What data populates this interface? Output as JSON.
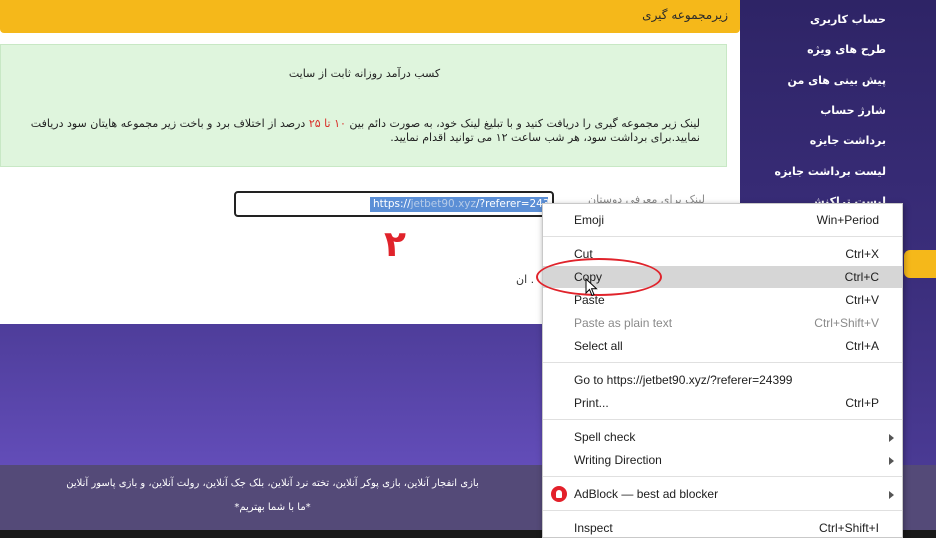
{
  "sidebar": {
    "items": [
      {
        "label": "حساب کاربری"
      },
      {
        "label": "طرح های ویژه"
      },
      {
        "label": "پیش بینی های من"
      },
      {
        "label": "شارژ حساب"
      },
      {
        "label": "برداشت جایزه"
      },
      {
        "label": "لیست برداشت جایزه"
      },
      {
        "label": "لیست تراکنش"
      }
    ]
  },
  "header": {
    "title": "زیرمجموعه گیری"
  },
  "info": {
    "heading": "کسب درآمد روزانه ثابت از سایت",
    "body_before": "لینک زیر مجموعه گیری را دریافت کنید و با تبلیغ لینک خود، به صورت دائم بین ",
    "body_highlight": "۱۰ تا ۲۵",
    "body_after": " درصد از اختلاف برد و باخت زیر مجموعه هایتان سود دریافت نمایید.برای برداشت سود، هر شب ساعت ۱۲ می توانید اقدام نمایید."
  },
  "referral": {
    "label": "لینک برای معرفی دوستان",
    "link_prefix": "https://",
    "link_blurred": "jetbet90.xyz",
    "link_suffix": "/?referer=24399"
  },
  "annotation": {
    "step_number": "۲"
  },
  "partial_text": "ان .",
  "footer": {
    "line1": "بازی انفجار آنلاین، بازی پوکر آنلاین، تخته نرد آنلاین، بلک جک آنلاین، رولت آنلاین، و بازی پاسور آنلاین",
    "line2": "*ما با شما بهتریم*"
  },
  "context_menu": {
    "items": [
      {
        "label": "Emoji",
        "shortcut": "Win+Period"
      },
      {
        "label": "Cut",
        "shortcut": "Ctrl+X"
      },
      {
        "label": "Copy",
        "shortcut": "Ctrl+C"
      },
      {
        "label": "Paste",
        "shortcut": "Ctrl+V"
      },
      {
        "label": "Paste as plain text",
        "shortcut": "Ctrl+Shift+V"
      },
      {
        "label": "Select all",
        "shortcut": "Ctrl+A"
      },
      {
        "label": "Go to https://jetbet90.xyz/?referer=24399",
        "shortcut": ""
      },
      {
        "label": "Print...",
        "shortcut": "Ctrl+P"
      },
      {
        "label": "Spell check",
        "shortcut": ""
      },
      {
        "label": "Writing Direction",
        "shortcut": ""
      },
      {
        "label": "AdBlock — best ad blocker",
        "shortcut": ""
      },
      {
        "label": "Inspect",
        "shortcut": "Ctrl+Shift+I"
      }
    ]
  },
  "colors": {
    "header_yellow": "#f5b81a",
    "info_green": "#dff5dd",
    "sidebar_purple": "#2e2466",
    "accent_red": "#e0232b",
    "selection_blue": "#5b8fd6"
  }
}
